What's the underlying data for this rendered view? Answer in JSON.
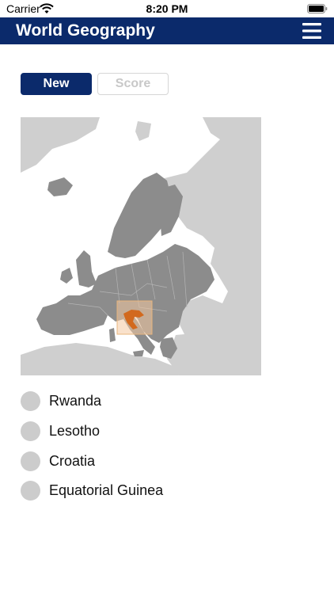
{
  "status_bar": {
    "carrier": "Carrier",
    "time": "8:20 PM",
    "wifi_icon": "wifi-icon",
    "battery_icon": "battery-icon"
  },
  "nav": {
    "title": "World Geography",
    "menu_icon": "hamburger-menu-icon",
    "background": "#0b2a6b"
  },
  "controls": {
    "new_label": "New",
    "score_label": "Score"
  },
  "map": {
    "region": "Europe",
    "highlighted_country": "Croatia",
    "highlight_color": "#d2691e"
  },
  "options": [
    {
      "label": "Rwanda"
    },
    {
      "label": "Lesotho"
    },
    {
      "label": "Croatia"
    },
    {
      "label": "Equatorial Guinea"
    }
  ]
}
